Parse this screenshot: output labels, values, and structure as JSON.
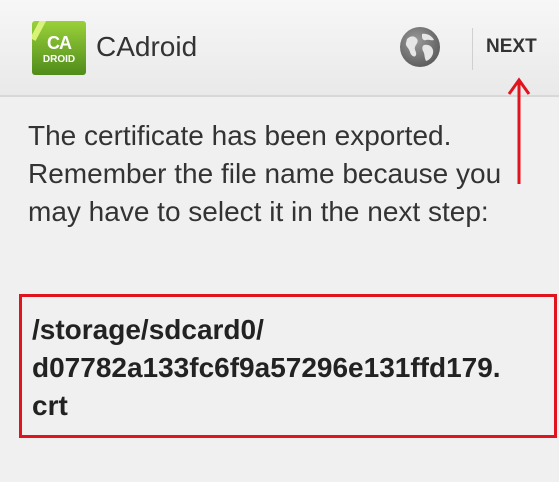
{
  "action_bar": {
    "app_icon_text_top": "CA",
    "app_icon_text_bottom": "DROID",
    "title": "CAdroid",
    "next_label": "NEXT"
  },
  "content": {
    "message": "The certificate has been exported. Remember the file name because you may have to select it in the next step:",
    "file_path_line1": "/storage/sdcard0/",
    "file_path_line2": "d07782a133fc6f9a57296e131ffd179.",
    "file_path_line3": "crt"
  },
  "icons": {
    "app": "cadroid-app-icon",
    "globe": "globe-icon",
    "annotation": "arrow-up-icon"
  },
  "colors": {
    "highlight": "#e0141e",
    "app_icon_green": "#6aa823",
    "text": "#333333"
  }
}
